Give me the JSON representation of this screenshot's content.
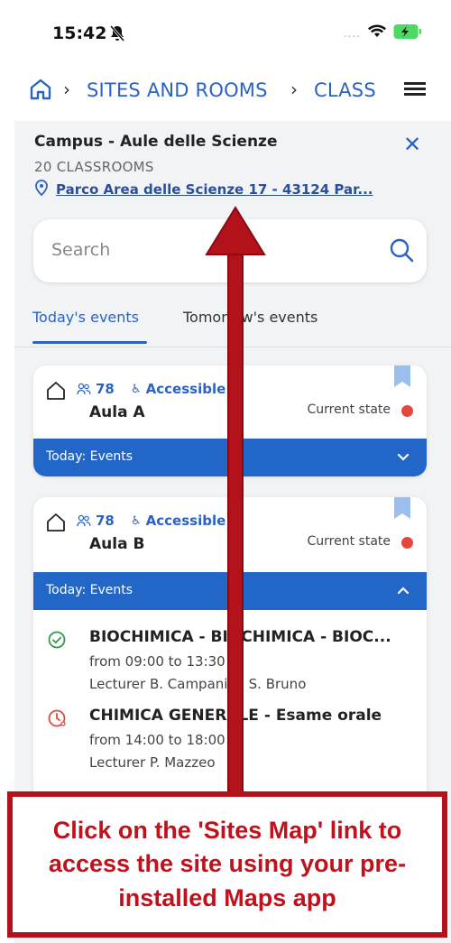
{
  "status_bar": {
    "time": "15:42",
    "signal": "....",
    "icons": [
      "bell-slash-icon",
      "wifi-icon",
      "battery-charging-icon"
    ]
  },
  "nav": {
    "crumbs": [
      "SITES AND ROOMS",
      "CLASS"
    ],
    "icons": [
      "home-icon",
      "chevron-right-icon",
      "menu-icon"
    ]
  },
  "site": {
    "title": "Campus - Aule delle Scienze",
    "count": "20 CLASSROOMS",
    "address": "Parco Area delle Scienze 17 - 43124 Par..."
  },
  "search": {
    "placeholder": "Search"
  },
  "tabs": [
    {
      "label": "Today's events",
      "active": true
    },
    {
      "label": "Tomorrow's events",
      "active": false
    }
  ],
  "rooms": [
    {
      "capacity": "78",
      "accessible": "Accessible",
      "name": "Aula A",
      "state_label": "Current state",
      "state_color": "#e6463c",
      "bar_label": "Today: Events",
      "expanded": false
    },
    {
      "capacity": "78",
      "accessible": "Accessible",
      "name": "Aula B",
      "state_label": "Current state",
      "state_color": "#e6463c",
      "bar_label": "Today: Events",
      "expanded": true,
      "events": [
        {
          "title": "BIOCHIMICA - BIOCHIMICA - BIOC...",
          "time": "from 09:00 to 13:30",
          "lecturer": "Lecturer B. Campanini, S. Bruno",
          "status_icon": "check-circle-icon"
        },
        {
          "title": "CHIMICA GENERALE - Esame orale",
          "time": "from 14:00 to 18:00",
          "lecturer": "Lecturer P. Mazzeo",
          "status_icon": "clock-person-icon"
        }
      ]
    }
  ],
  "callout": {
    "text": "Click on the 'Sites Map' link to access the site using your pre-installed Maps app"
  },
  "colors": {
    "accent": "#2b63c4",
    "bar": "#2267c8",
    "annotation": "#b3121b",
    "status_red": "#e6463c"
  }
}
